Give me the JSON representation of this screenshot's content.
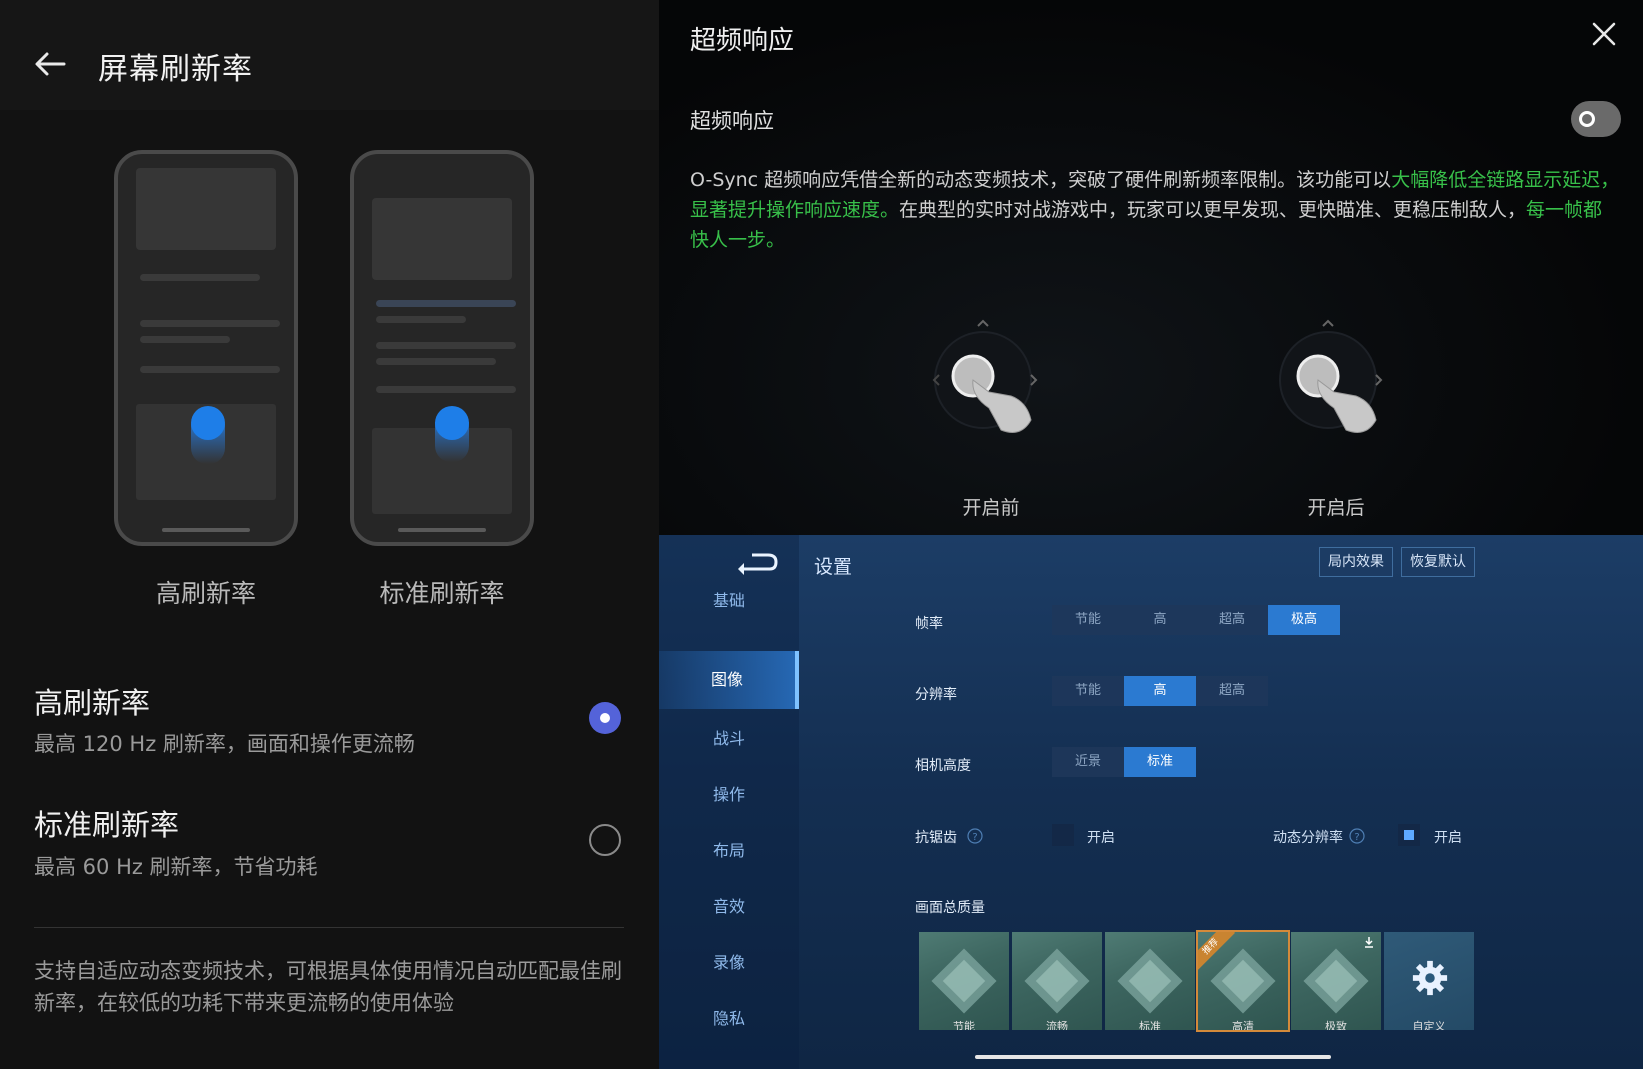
{
  "left": {
    "title": "屏幕刷新率",
    "phones": [
      {
        "label": "高刷新率"
      },
      {
        "label": "标准刷新率"
      }
    ],
    "options": [
      {
        "title": "高刷新率",
        "desc": "最高 120 Hz 刷新率，画面和操作更流畅",
        "selected": true
      },
      {
        "title": "标准刷新率",
        "desc": "最高 60 Hz 刷新率，节省功耗",
        "selected": false
      }
    ],
    "footnote": "支持自适应动态变频技术，可根据具体使用情况自动匹配最佳刷新率，在较低的功耗下带来更流畅的使用体验"
  },
  "panel": {
    "title": "超频响应",
    "toggle_label": "超频响应",
    "toggle_on": false,
    "desc_plain_1": "O-Sync 超频响应凭借全新的动态变频技术，突破了硬件刷新频率限制。该功能可以",
    "desc_hl_1": "大幅降低全链路显示延迟，显著提升操作响应速度。",
    "desc_plain_2": "在典型的实时对战游戏中，玩家可以更早发现、更快瞄准、更稳压制敌人，",
    "desc_hl_2": "每一帧都快人一步。",
    "before_label": "开启前",
    "after_label": "开启后",
    "highlight_color": "#38c04a"
  },
  "game": {
    "title": "设置",
    "btn_effect": "局内效果",
    "btn_reset": "恢复默认",
    "sidebar": [
      "基础",
      "图像",
      "战斗",
      "操作",
      "布局",
      "音效",
      "录像",
      "隐私"
    ],
    "active_tab": "图像",
    "rows": {
      "fps": {
        "label": "帧率",
        "options": [
          "节能",
          "高",
          "超高",
          "极高"
        ],
        "selected": "极高"
      },
      "resolution": {
        "label": "分辨率",
        "options": [
          "节能",
          "高",
          "超高"
        ],
        "selected": "高"
      },
      "camera": {
        "label": "相机高度",
        "options": [
          "近景",
          "标准"
        ],
        "selected": "标准"
      },
      "aa": {
        "label": "抗锯齿",
        "check_label": "开启",
        "checked": false
      },
      "dynres": {
        "label": "动态分辨率",
        "check_label": "开启",
        "checked": true
      }
    },
    "quality_label": "画面总质量",
    "quality_presets": [
      "节能",
      "流畅",
      "标准",
      "高清",
      "极致",
      "自定义"
    ],
    "recommend_badge": "推荐",
    "accent_color": "#2b7ad1"
  }
}
